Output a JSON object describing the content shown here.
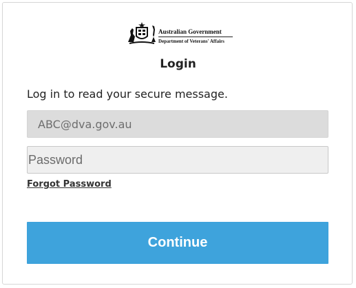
{
  "logo": {
    "line1": "Australian Government",
    "line2": "Department of Veterans' Affairs",
    "icon": "coat-of-arms-icon"
  },
  "login": {
    "title": "Login",
    "intro": "Log in to read your secure message.",
    "email_value": "ABC@dva.gov.au",
    "password_placeholder": "Password",
    "forgot_label": "Forgot Password",
    "continue_label": "Continue"
  },
  "colors": {
    "button": "#3ea3dc",
    "email_bg": "#dcdcdc",
    "password_bg": "#efefef"
  }
}
